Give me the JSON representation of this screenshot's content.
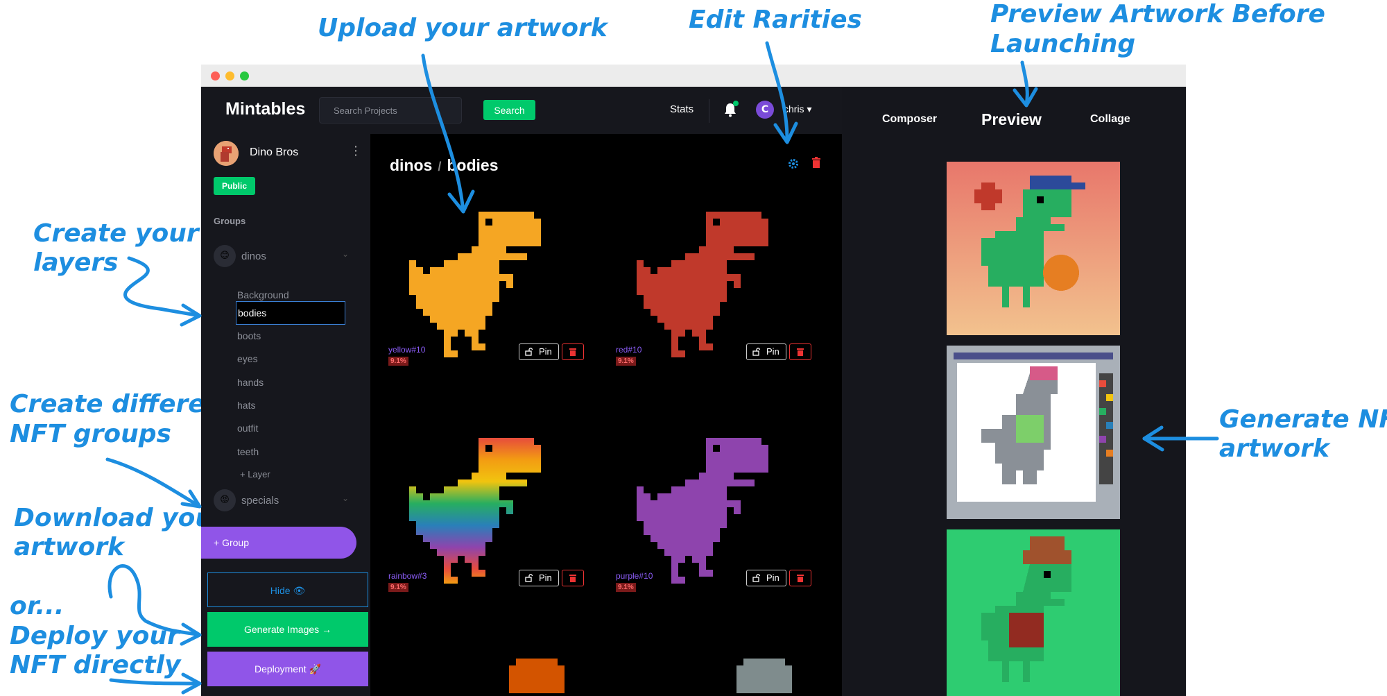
{
  "callouts": {
    "upload": "Upload your artwork",
    "rarities": "Edit Rarities",
    "preview_line1": "Preview Artwork Before",
    "preview_line2": "Launching",
    "layers_line1": "Create your",
    "layers_line2": "layers",
    "groups_line1": "Create different",
    "groups_line2": "NFT groups",
    "download_line1": "Download your",
    "download_line2": "artwork",
    "or": "or...",
    "deploy_line1": "Deploy your",
    "deploy_line2": "NFT directly",
    "generate_line1": "Generate NFT",
    "generate_line2": "artwork"
  },
  "nav": {
    "brand": "Mintables",
    "search_placeholder": "Search Projects",
    "search_button": "Search",
    "stats": "Stats",
    "user_initial": "C",
    "username": "chris ▾"
  },
  "sidebar": {
    "project_name": "Dino Bros",
    "visibility": "Public",
    "groups_label": "Groups",
    "groups": [
      {
        "name": "dinos",
        "icon": "😊"
      },
      {
        "name": "specials",
        "icon": "😡"
      }
    ],
    "layers": [
      "Background",
      "bodies",
      "boots",
      "eyes",
      "hands",
      "hats",
      "outfit",
      "teeth"
    ],
    "add_layer": "+ Layer",
    "add_group": "+ Group",
    "hide": "Hide 👁",
    "generate": "Generate Images →",
    "deployment": "Deployment 🚀"
  },
  "main": {
    "breadcrumb_group": "dinos",
    "breadcrumb_sep": "/",
    "breadcrumb_layer": "bodies",
    "pin_label": "Pin",
    "cards": [
      {
        "name": "yellow#10",
        "rarity": "9.1%",
        "color": "#f5a623"
      },
      {
        "name": "red#10",
        "rarity": "9.1%",
        "color": "#c0392b"
      },
      {
        "name": "rainbow#3",
        "rarity": "9.1%",
        "color": "rainbow"
      },
      {
        "name": "purple#10",
        "rarity": "9.1%",
        "color": "#8e44ad"
      }
    ]
  },
  "preview": {
    "tabs": [
      "Composer",
      "Preview",
      "Collage"
    ],
    "active_tab": "Preview"
  },
  "colors": {
    "accent_blue": "#1d8ee0",
    "green": "#00c96b",
    "purple": "#9055e8"
  }
}
